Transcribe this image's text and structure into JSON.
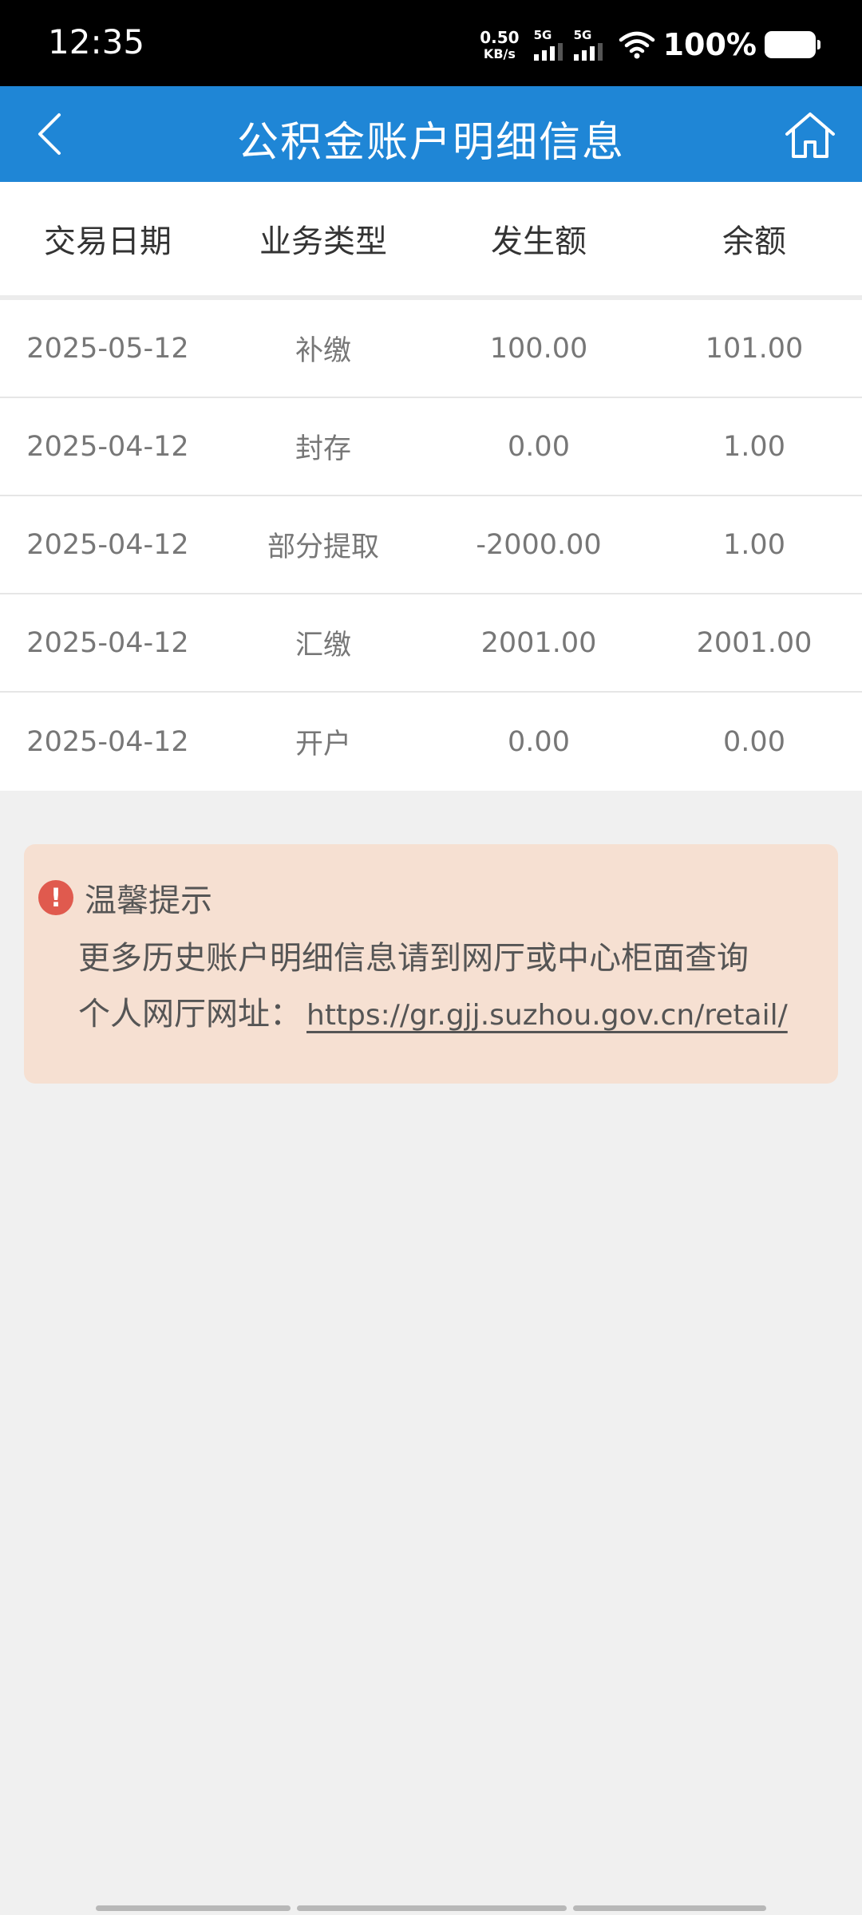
{
  "status_bar": {
    "time": "12:35",
    "net_speed_value": "0.50",
    "net_speed_unit": "KB/s",
    "sim1_label": "5G",
    "sim2_label": "5G",
    "battery_percent": "100%"
  },
  "nav": {
    "title": "公积金账户明细信息",
    "back_icon": "chevron-left-icon",
    "home_icon": "home-icon"
  },
  "table": {
    "headers": [
      "交易日期",
      "业务类型",
      "发生额",
      "余额"
    ],
    "rows": [
      [
        "2025-05-12",
        "补缴",
        "100.00",
        "101.00"
      ],
      [
        "2025-04-12",
        "封存",
        "0.00",
        "1.00"
      ],
      [
        "2025-04-12",
        "部分提取",
        "-2000.00",
        "1.00"
      ],
      [
        "2025-04-12",
        "汇缴",
        "2001.00",
        "2001.00"
      ],
      [
        "2025-04-12",
        "开户",
        "0.00",
        "0.00"
      ]
    ]
  },
  "tip": {
    "icon": "alert-icon",
    "title": "温馨提示",
    "line1": "更多历史账户明细信息请到网厅或中心柜面查询",
    "line2_prefix": "个人网厅网址：",
    "link": "https://gr.gjj.suzhou.gov.cn/retail/"
  },
  "colors": {
    "nav_bg": "#1f86d6",
    "tip_bg": "#f6e0d2",
    "alert_red": "#e05a4e"
  }
}
